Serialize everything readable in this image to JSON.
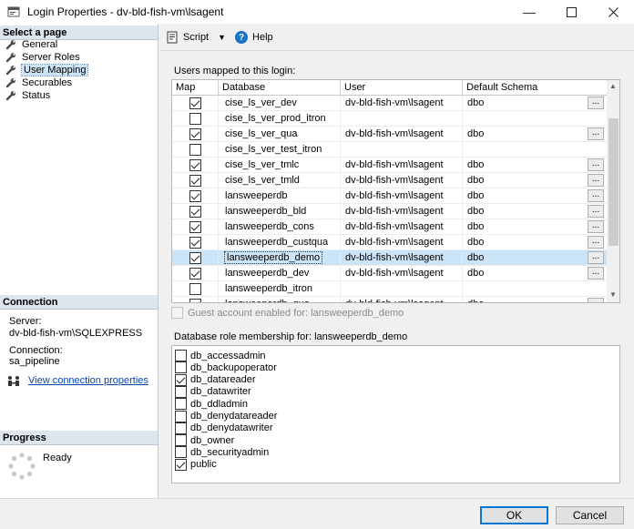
{
  "window": {
    "title": "Login Properties - dv-bld-fish-vm\\lsagent",
    "min_icon": "minimize-icon",
    "max_icon": "maximize-icon",
    "close_icon": "close-icon"
  },
  "left_pane": {
    "select_page_header": "Select a page",
    "pages": [
      {
        "label": "General",
        "icon": "wrench-icon",
        "selected": false
      },
      {
        "label": "Server Roles",
        "icon": "wrench-icon",
        "selected": false
      },
      {
        "label": "User Mapping",
        "icon": "wrench-icon",
        "selected": true
      },
      {
        "label": "Securables",
        "icon": "wrench-icon",
        "selected": false
      },
      {
        "label": "Status",
        "icon": "wrench-icon",
        "selected": false
      }
    ],
    "connection_header": "Connection",
    "server_label": "Server:",
    "server_value": "dv-bld-fish-vm\\SQLEXPRESS",
    "connection_label": "Connection:",
    "connection_value": "sa_pipeline",
    "view_connection_link": "View connection properties",
    "progress_header": "Progress",
    "progress_status": "Ready"
  },
  "toolbar": {
    "script_label": "Script",
    "help_label": "Help",
    "help_glyph": "?"
  },
  "users_mapped": {
    "label": "Users mapped to this login:",
    "columns": [
      "Map",
      "Database",
      "User",
      "Default Schema"
    ],
    "rows": [
      {
        "map": true,
        "database": "cise_ls_ver_dev",
        "user": "dv-bld-fish-vm\\lsagent",
        "schema": "dbo",
        "selected": false
      },
      {
        "map": false,
        "database": "cise_ls_ver_prod_itron",
        "user": "",
        "schema": "",
        "selected": false
      },
      {
        "map": true,
        "database": "cise_ls_ver_qua",
        "user": "dv-bld-fish-vm\\lsagent",
        "schema": "dbo",
        "selected": false
      },
      {
        "map": false,
        "database": "cise_ls_ver_test_itron",
        "user": "",
        "schema": "",
        "selected": false
      },
      {
        "map": true,
        "database": "cise_ls_ver_tmlc",
        "user": "dv-bld-fish-vm\\lsagent",
        "schema": "dbo",
        "selected": false
      },
      {
        "map": true,
        "database": "cise_ls_ver_tmld",
        "user": "dv-bld-fish-vm\\lsagent",
        "schema": "dbo",
        "selected": false
      },
      {
        "map": true,
        "database": "lansweeperdb",
        "user": "dv-bld-fish-vm\\lsagent",
        "schema": "dbo",
        "selected": false
      },
      {
        "map": true,
        "database": "lansweeperdb_bld",
        "user": "dv-bld-fish-vm\\lsagent",
        "schema": "dbo",
        "selected": false
      },
      {
        "map": true,
        "database": "lansweeperdb_cons",
        "user": "dv-bld-fish-vm\\lsagent",
        "schema": "dbo",
        "selected": false
      },
      {
        "map": true,
        "database": "lansweeperdb_custqua",
        "user": "dv-bld-fish-vm\\lsagent",
        "schema": "dbo",
        "selected": false
      },
      {
        "map": true,
        "database": "lansweeperdb_demo",
        "user": "dv-bld-fish-vm\\lsagent",
        "schema": "dbo",
        "selected": true
      },
      {
        "map": true,
        "database": "lansweeperdb_dev",
        "user": "dv-bld-fish-vm\\lsagent",
        "schema": "dbo",
        "selected": false
      },
      {
        "map": false,
        "database": "lansweeperdb_itron",
        "user": "",
        "schema": "",
        "selected": false
      },
      {
        "map": true,
        "database": "lansweeperdb_qua",
        "user": "dv-bld-fish-vm\\lsagent",
        "schema": "dbo",
        "selected": false
      }
    ],
    "ellipsis": "..."
  },
  "guest_account": {
    "label": "Guest account enabled for: lansweeperdb_demo",
    "checked": false
  },
  "role_membership": {
    "label": "Database role membership for: lansweeperdb_demo",
    "roles": [
      {
        "label": "db_accessadmin",
        "checked": false
      },
      {
        "label": "db_backupoperator",
        "checked": false
      },
      {
        "label": "db_datareader",
        "checked": true
      },
      {
        "label": "db_datawriter",
        "checked": false
      },
      {
        "label": "db_ddladmin",
        "checked": false
      },
      {
        "label": "db_denydatareader",
        "checked": false
      },
      {
        "label": "db_denydatawriter",
        "checked": false
      },
      {
        "label": "db_owner",
        "checked": false
      },
      {
        "label": "db_securityadmin",
        "checked": false
      },
      {
        "label": "public",
        "checked": true
      }
    ]
  },
  "buttons": {
    "ok": "OK",
    "cancel": "Cancel"
  },
  "colors": {
    "selection": "#cce4f7",
    "section_header": "#dde6ef",
    "link": "#0645ad",
    "help_blue": "#1a73c8"
  }
}
